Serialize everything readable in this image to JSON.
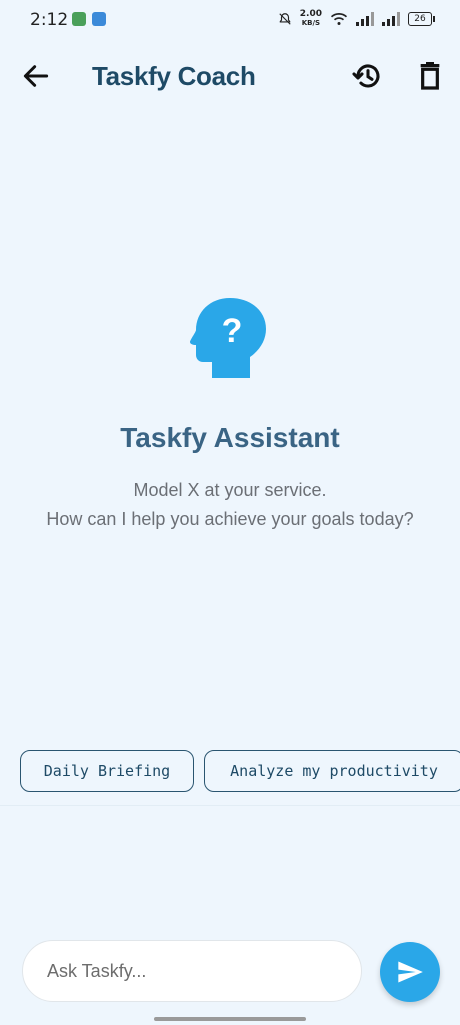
{
  "status_bar": {
    "time": "2:12",
    "net_speed_value": "2.00",
    "net_speed_unit": "KB/S",
    "battery": "26"
  },
  "app_bar": {
    "title": "Taskfy Coach",
    "back_icon": "arrow-left-icon",
    "history_icon": "history-icon",
    "delete_icon": "trash-icon"
  },
  "hero": {
    "title": "Taskfy Assistant",
    "subtitle_line1": "Model X at your service.",
    "subtitle_line2": "How can I help you achieve your goals today?"
  },
  "suggestions": [
    {
      "label": "Daily Briefing"
    },
    {
      "label": "Analyze my productivity"
    }
  ],
  "chat": {
    "placeholder": "Ask Taskfy..."
  },
  "colors": {
    "background": "#eef6fd",
    "title": "#1e4a66",
    "accent": "#2aa7e8",
    "assistant_title": "#3a6484"
  }
}
